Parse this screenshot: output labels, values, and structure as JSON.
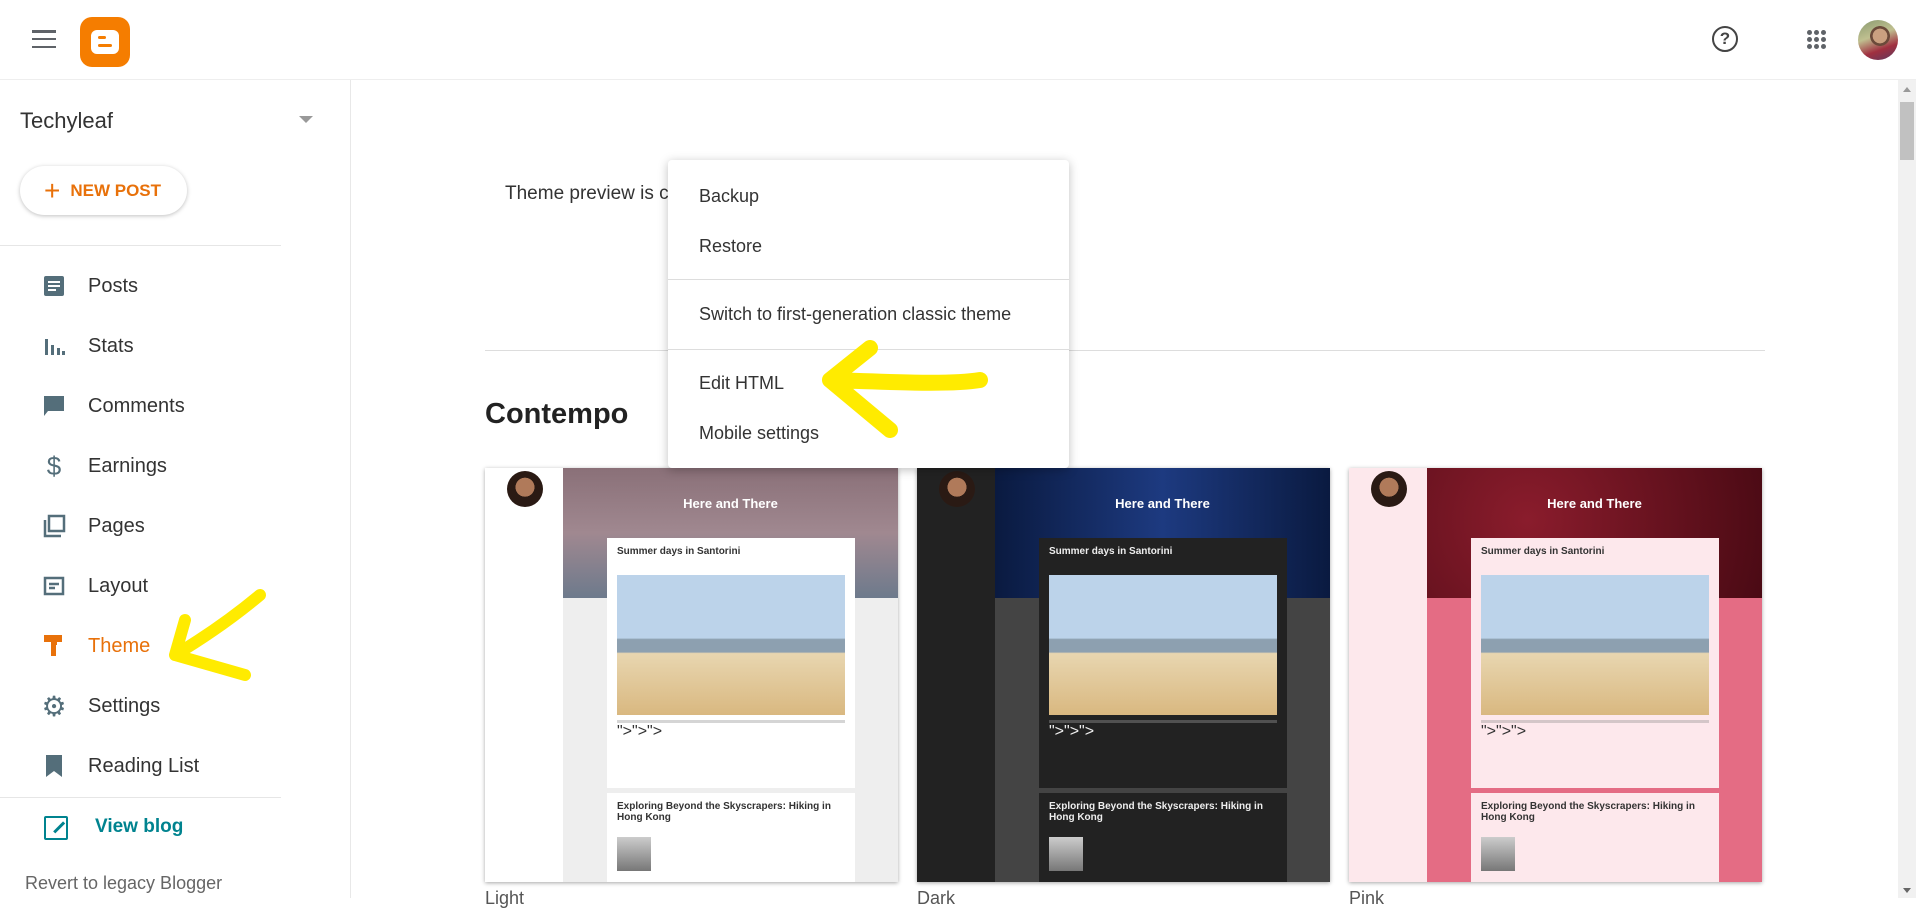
{
  "header": {
    "menu_icon": "hamburger-icon",
    "logo": "blogger-logo",
    "help_icon": "help-circle-icon",
    "apps_icon": "apps-grid-icon",
    "avatar": "user-avatar"
  },
  "sidebar": {
    "blog_name": "Techyleaf",
    "new_post_label": "NEW POST",
    "items": [
      {
        "label": "Posts",
        "icon": "posts-icon"
      },
      {
        "label": "Stats",
        "icon": "stats-icon"
      },
      {
        "label": "Comments",
        "icon": "comments-icon"
      },
      {
        "label": "Earnings",
        "icon": "dollar-icon"
      },
      {
        "label": "Pages",
        "icon": "pages-icon"
      },
      {
        "label": "Layout",
        "icon": "layout-icon"
      },
      {
        "label": "Theme",
        "icon": "theme-roller-icon",
        "active": true
      },
      {
        "label": "Settings",
        "icon": "gear-icon"
      },
      {
        "label": "Reading List",
        "icon": "bookmark-icon"
      }
    ],
    "view_blog_label": "View blog",
    "revert_label": "Revert to legacy Blogger"
  },
  "main": {
    "preview_notice": "Theme preview is currently unavailable.",
    "theme_family": "Contempo",
    "cards": [
      {
        "variant": "Light",
        "blog_title": "Here and There",
        "post1": "Summer days in Santorini",
        "post2": "Exploring Beyond the Skyscrapers: Hiking in Hong Kong"
      },
      {
        "variant": "Dark",
        "blog_title": "Here and There",
        "post1": "Summer days in Santorini",
        "post2": "Exploring Beyond the Skyscrapers: Hiking in Hong Kong"
      },
      {
        "variant": "Pink",
        "blog_title": "Here and There",
        "post1": "Summer days in Santorini",
        "post2": "Exploring Beyond the Skyscrapers: Hiking in Hong Kong"
      }
    ]
  },
  "dropdown": {
    "items": [
      "Backup",
      "Restore",
      "Switch to first-generation classic theme",
      "Edit HTML",
      "Mobile settings"
    ]
  },
  "colors": {
    "accent": "#e8710a",
    "link": "#00838f",
    "annotation": "#ffeb00"
  }
}
